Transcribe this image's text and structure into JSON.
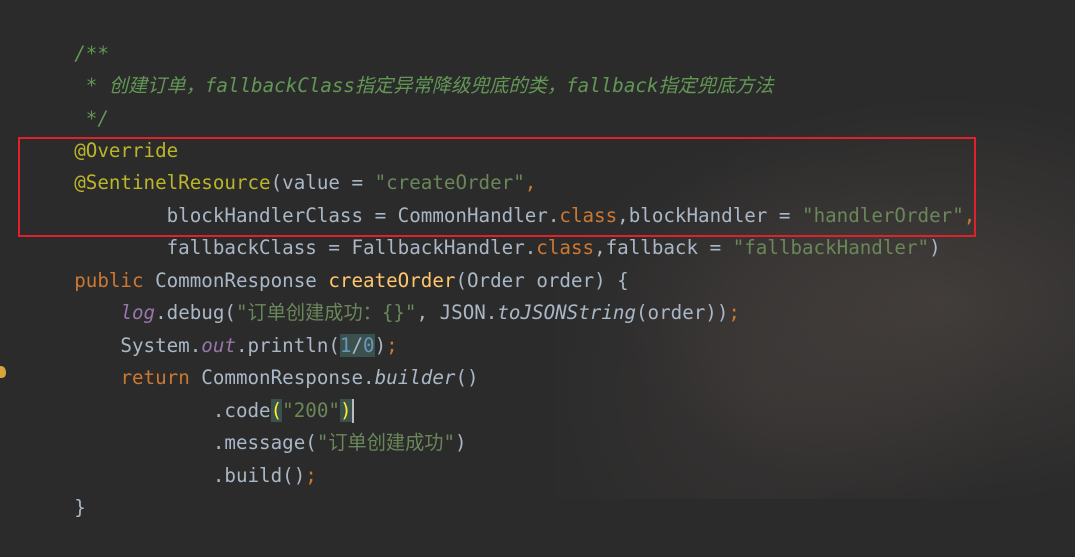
{
  "code": {
    "l1": "/**",
    "l2_star": " * ",
    "l2_a": "创建订单，",
    "l2_b": "fallbackClass",
    "l2_c": "指定异常降级兜底的类，",
    "l2_d": "fallback",
    "l2_e": "指定兜底方法",
    "l3": " */",
    "l4": "@Override",
    "l5_ann": "@SentinelResource",
    "l5_a": "(value = ",
    "l5_str": "\"createOrder\"",
    "l5_comma": ",",
    "l6_a": "        blockHandlerClass = CommonHandler.",
    "l6_kw": "class",
    "l6_b": ",blockHandler = ",
    "l6_str": "\"handlerOrder\"",
    "l6_comma": ",",
    "l7_a": "        fallbackClass = FallbackHandler.",
    "l7_kw": "class",
    "l7_b": ",fallback = ",
    "l7_str": "\"fallbackHandler\"",
    "l7_c": ")",
    "l8_kw": "public",
    "l8_a": " CommonResponse ",
    "l8_fn": "createOrder",
    "l8_b": "(Order order) {",
    "l9_pre": "    ",
    "l9_field": "log",
    "l9_a": ".debug(",
    "l9_str": "\"订单创建成功：{}\"",
    "l9_b": ", JSON.",
    "l9_ital": "toJSONString",
    "l9_c": "(order))",
    "l9_semi": ";",
    "l10_a": "    System.",
    "l10_field": "out",
    "l10_b": ".println(",
    "l10_n1": "1",
    "l10_slash": "/",
    "l10_n2": "0",
    "l10_c": ")",
    "l10_semi": ";",
    "l11_pre": "    ",
    "l11_kw": "return",
    "l11_a": " CommonResponse.",
    "l11_ital": "builder",
    "l11_b": "()",
    "l12_a": "            .code",
    "l12_p1": "(",
    "l12_str": "\"200\"",
    "l12_p2": ")",
    "l13_a": "            .message(",
    "l13_str": "\"订单创建成功\"",
    "l13_b": ")",
    "l14_a": "            .build()",
    "l14_semi": ";",
    "l15": "}"
  }
}
